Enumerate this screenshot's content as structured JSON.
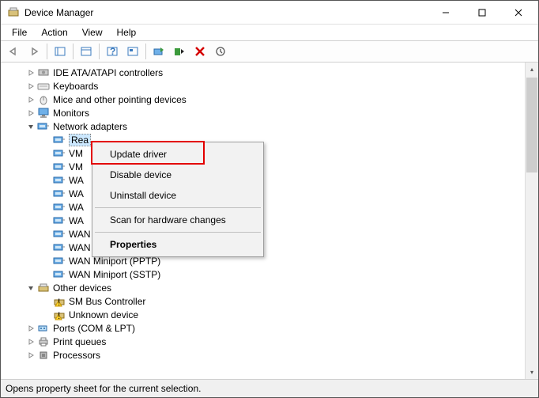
{
  "title": "Device Manager",
  "menubar": [
    "File",
    "Action",
    "View",
    "Help"
  ],
  "tree": [
    {
      "exp": ">",
      "icon": "ide",
      "label": "IDE ATA/ATAPI controllers",
      "indent": 1
    },
    {
      "exp": ">",
      "icon": "keyboard",
      "label": "Keyboards",
      "indent": 1
    },
    {
      "exp": ">",
      "icon": "mouse",
      "label": "Mice and other pointing devices",
      "indent": 1
    },
    {
      "exp": ">",
      "icon": "monitor",
      "label": "Monitors",
      "indent": 1
    },
    {
      "exp": "v",
      "icon": "net",
      "label": "Network adapters",
      "indent": 1
    },
    {
      "exp": "",
      "icon": "net",
      "label": "Rea",
      "indent": 2,
      "selected": true
    },
    {
      "exp": "",
      "icon": "net",
      "label": "VM",
      "indent": 2
    },
    {
      "exp": "",
      "icon": "net",
      "label": "VM",
      "indent": 2
    },
    {
      "exp": "",
      "icon": "net",
      "label": "WA",
      "indent": 2
    },
    {
      "exp": "",
      "icon": "net",
      "label": "WA",
      "indent": 2
    },
    {
      "exp": "",
      "icon": "net",
      "label": "WA",
      "indent": 2
    },
    {
      "exp": "",
      "icon": "net",
      "label": "WA",
      "indent": 2
    },
    {
      "exp": "",
      "icon": "net",
      "label": "WAN Miniport (Network Monitor)",
      "indent": 2
    },
    {
      "exp": "",
      "icon": "net",
      "label": "WAN Miniport (PPPOE)",
      "indent": 2
    },
    {
      "exp": "",
      "icon": "net",
      "label": "WAN Miniport (PPTP)",
      "indent": 2
    },
    {
      "exp": "",
      "icon": "net",
      "label": "WAN Miniport (SSTP)",
      "indent": 2
    },
    {
      "exp": "v",
      "icon": "other",
      "label": "Other devices",
      "indent": 1
    },
    {
      "exp": "",
      "icon": "warn",
      "label": "SM Bus Controller",
      "indent": 2
    },
    {
      "exp": "",
      "icon": "warn",
      "label": "Unknown device",
      "indent": 2
    },
    {
      "exp": ">",
      "icon": "port",
      "label": "Ports (COM & LPT)",
      "indent": 1
    },
    {
      "exp": ">",
      "icon": "printer",
      "label": "Print queues",
      "indent": 1
    },
    {
      "exp": ">",
      "icon": "cpu",
      "label": "Processors",
      "indent": 1
    }
  ],
  "context_menu": [
    {
      "label": "Update driver",
      "bold": false
    },
    {
      "label": "Disable device",
      "bold": false
    },
    {
      "label": "Uninstall device",
      "bold": false
    },
    {
      "sep": true
    },
    {
      "label": "Scan for hardware changes",
      "bold": false
    },
    {
      "sep": true
    },
    {
      "label": "Properties",
      "bold": true
    }
  ],
  "status": "Opens property sheet for the current selection."
}
